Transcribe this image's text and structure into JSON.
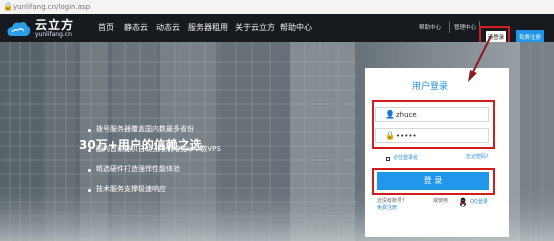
{
  "address_bar": {
    "url": "yunlifang.cn/login.asp"
  },
  "header": {
    "logo_name": "云立方",
    "logo_domain": "yunlifang.cn",
    "menu": [
      "首页",
      "静态云",
      "动态云",
      "服务器租用",
      "关于云立方",
      "帮助中心"
    ],
    "help_link": "帮助中心",
    "console_link": "管理中心",
    "login_button": "请登录",
    "register_button": "免费注册"
  },
  "hero": {
    "headline": "30万+用户的信赖之选",
    "features": [
      "拨号服务器覆盖国内数最多省份",
      "国内首家提供自助无限制增加ip个数VPS",
      "精选硬件打造强悍性能体验",
      "技术服务支撑极速响应"
    ]
  },
  "login": {
    "title": "用户登录",
    "username": "zhuce",
    "password_mask": "•••••",
    "remember": "记住登录名",
    "forgot": "忘记密码?",
    "submit": "登 录",
    "other_login": "还没有账号?",
    "register_link": "免费注册",
    "login_alt": "或使用",
    "qq_label": "QQ登录"
  },
  "colors": {
    "nav": "#171b20",
    "accent": "#2196ea",
    "highlight": "#d21d1d"
  },
  "icons": {
    "lock": "lock-icon",
    "user": "user-icon",
    "password": "lock-icon",
    "qq": "qq-icon"
  }
}
